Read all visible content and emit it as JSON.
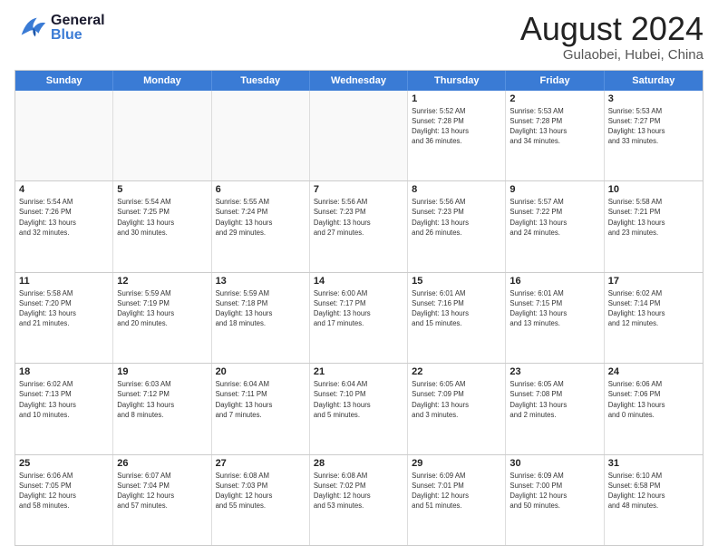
{
  "header": {
    "logo_general": "General",
    "logo_blue": "Blue",
    "title": "August 2024",
    "subtitle": "Gulaobei, Hubei, China"
  },
  "weekdays": [
    "Sunday",
    "Monday",
    "Tuesday",
    "Wednesday",
    "Thursday",
    "Friday",
    "Saturday"
  ],
  "rows": [
    [
      {
        "day": "",
        "info": ""
      },
      {
        "day": "",
        "info": ""
      },
      {
        "day": "",
        "info": ""
      },
      {
        "day": "",
        "info": ""
      },
      {
        "day": "1",
        "info": "Sunrise: 5:52 AM\nSunset: 7:28 PM\nDaylight: 13 hours\nand 36 minutes."
      },
      {
        "day": "2",
        "info": "Sunrise: 5:53 AM\nSunset: 7:28 PM\nDaylight: 13 hours\nand 34 minutes."
      },
      {
        "day": "3",
        "info": "Sunrise: 5:53 AM\nSunset: 7:27 PM\nDaylight: 13 hours\nand 33 minutes."
      }
    ],
    [
      {
        "day": "4",
        "info": "Sunrise: 5:54 AM\nSunset: 7:26 PM\nDaylight: 13 hours\nand 32 minutes."
      },
      {
        "day": "5",
        "info": "Sunrise: 5:54 AM\nSunset: 7:25 PM\nDaylight: 13 hours\nand 30 minutes."
      },
      {
        "day": "6",
        "info": "Sunrise: 5:55 AM\nSunset: 7:24 PM\nDaylight: 13 hours\nand 29 minutes."
      },
      {
        "day": "7",
        "info": "Sunrise: 5:56 AM\nSunset: 7:23 PM\nDaylight: 13 hours\nand 27 minutes."
      },
      {
        "day": "8",
        "info": "Sunrise: 5:56 AM\nSunset: 7:23 PM\nDaylight: 13 hours\nand 26 minutes."
      },
      {
        "day": "9",
        "info": "Sunrise: 5:57 AM\nSunset: 7:22 PM\nDaylight: 13 hours\nand 24 minutes."
      },
      {
        "day": "10",
        "info": "Sunrise: 5:58 AM\nSunset: 7:21 PM\nDaylight: 13 hours\nand 23 minutes."
      }
    ],
    [
      {
        "day": "11",
        "info": "Sunrise: 5:58 AM\nSunset: 7:20 PM\nDaylight: 13 hours\nand 21 minutes."
      },
      {
        "day": "12",
        "info": "Sunrise: 5:59 AM\nSunset: 7:19 PM\nDaylight: 13 hours\nand 20 minutes."
      },
      {
        "day": "13",
        "info": "Sunrise: 5:59 AM\nSunset: 7:18 PM\nDaylight: 13 hours\nand 18 minutes."
      },
      {
        "day": "14",
        "info": "Sunrise: 6:00 AM\nSunset: 7:17 PM\nDaylight: 13 hours\nand 17 minutes."
      },
      {
        "day": "15",
        "info": "Sunrise: 6:01 AM\nSunset: 7:16 PM\nDaylight: 13 hours\nand 15 minutes."
      },
      {
        "day": "16",
        "info": "Sunrise: 6:01 AM\nSunset: 7:15 PM\nDaylight: 13 hours\nand 13 minutes."
      },
      {
        "day": "17",
        "info": "Sunrise: 6:02 AM\nSunset: 7:14 PM\nDaylight: 13 hours\nand 12 minutes."
      }
    ],
    [
      {
        "day": "18",
        "info": "Sunrise: 6:02 AM\nSunset: 7:13 PM\nDaylight: 13 hours\nand 10 minutes."
      },
      {
        "day": "19",
        "info": "Sunrise: 6:03 AM\nSunset: 7:12 PM\nDaylight: 13 hours\nand 8 minutes."
      },
      {
        "day": "20",
        "info": "Sunrise: 6:04 AM\nSunset: 7:11 PM\nDaylight: 13 hours\nand 7 minutes."
      },
      {
        "day": "21",
        "info": "Sunrise: 6:04 AM\nSunset: 7:10 PM\nDaylight: 13 hours\nand 5 minutes."
      },
      {
        "day": "22",
        "info": "Sunrise: 6:05 AM\nSunset: 7:09 PM\nDaylight: 13 hours\nand 3 minutes."
      },
      {
        "day": "23",
        "info": "Sunrise: 6:05 AM\nSunset: 7:08 PM\nDaylight: 13 hours\nand 2 minutes."
      },
      {
        "day": "24",
        "info": "Sunrise: 6:06 AM\nSunset: 7:06 PM\nDaylight: 13 hours\nand 0 minutes."
      }
    ],
    [
      {
        "day": "25",
        "info": "Sunrise: 6:06 AM\nSunset: 7:05 PM\nDaylight: 12 hours\nand 58 minutes."
      },
      {
        "day": "26",
        "info": "Sunrise: 6:07 AM\nSunset: 7:04 PM\nDaylight: 12 hours\nand 57 minutes."
      },
      {
        "day": "27",
        "info": "Sunrise: 6:08 AM\nSunset: 7:03 PM\nDaylight: 12 hours\nand 55 minutes."
      },
      {
        "day": "28",
        "info": "Sunrise: 6:08 AM\nSunset: 7:02 PM\nDaylight: 12 hours\nand 53 minutes."
      },
      {
        "day": "29",
        "info": "Sunrise: 6:09 AM\nSunset: 7:01 PM\nDaylight: 12 hours\nand 51 minutes."
      },
      {
        "day": "30",
        "info": "Sunrise: 6:09 AM\nSunset: 7:00 PM\nDaylight: 12 hours\nand 50 minutes."
      },
      {
        "day": "31",
        "info": "Sunrise: 6:10 AM\nSunset: 6:58 PM\nDaylight: 12 hours\nand 48 minutes."
      }
    ]
  ]
}
